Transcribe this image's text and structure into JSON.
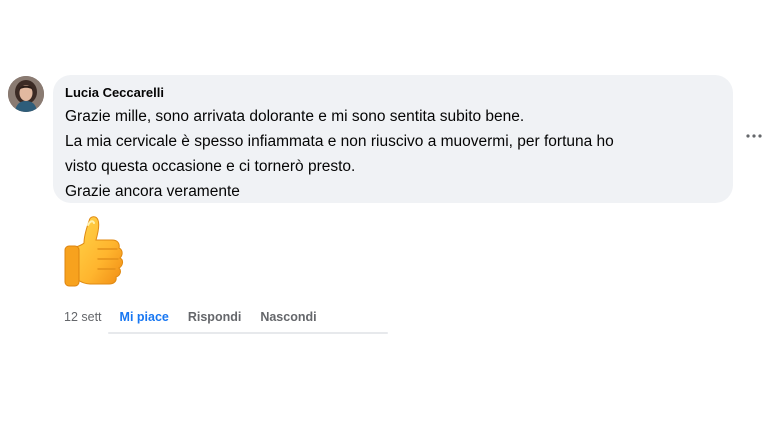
{
  "comment": {
    "author": "Lucia Ceccarelli",
    "lines": [
      "Grazie mille, sono arrivata dolorante e mi sono sentita subito bene.",
      "La mia cervicale è spesso infiammata e non riuscivo a muovermi, per fortuna ho",
      "visto questa occasione e ci tornerò presto.",
      "Grazie ancora veramente"
    ],
    "sticker": "thumbs-up-emoji",
    "options_icon": "more-horizontal-icon"
  },
  "actions": {
    "time": "12 sett",
    "like_label": "Mi piace",
    "reply_label": "Rispondi",
    "hide_label": "Nascondi"
  },
  "colors": {
    "bubble": "#f0f2f5",
    "liked": "#1877f2",
    "muted": "#65676b",
    "text": "#050505"
  }
}
